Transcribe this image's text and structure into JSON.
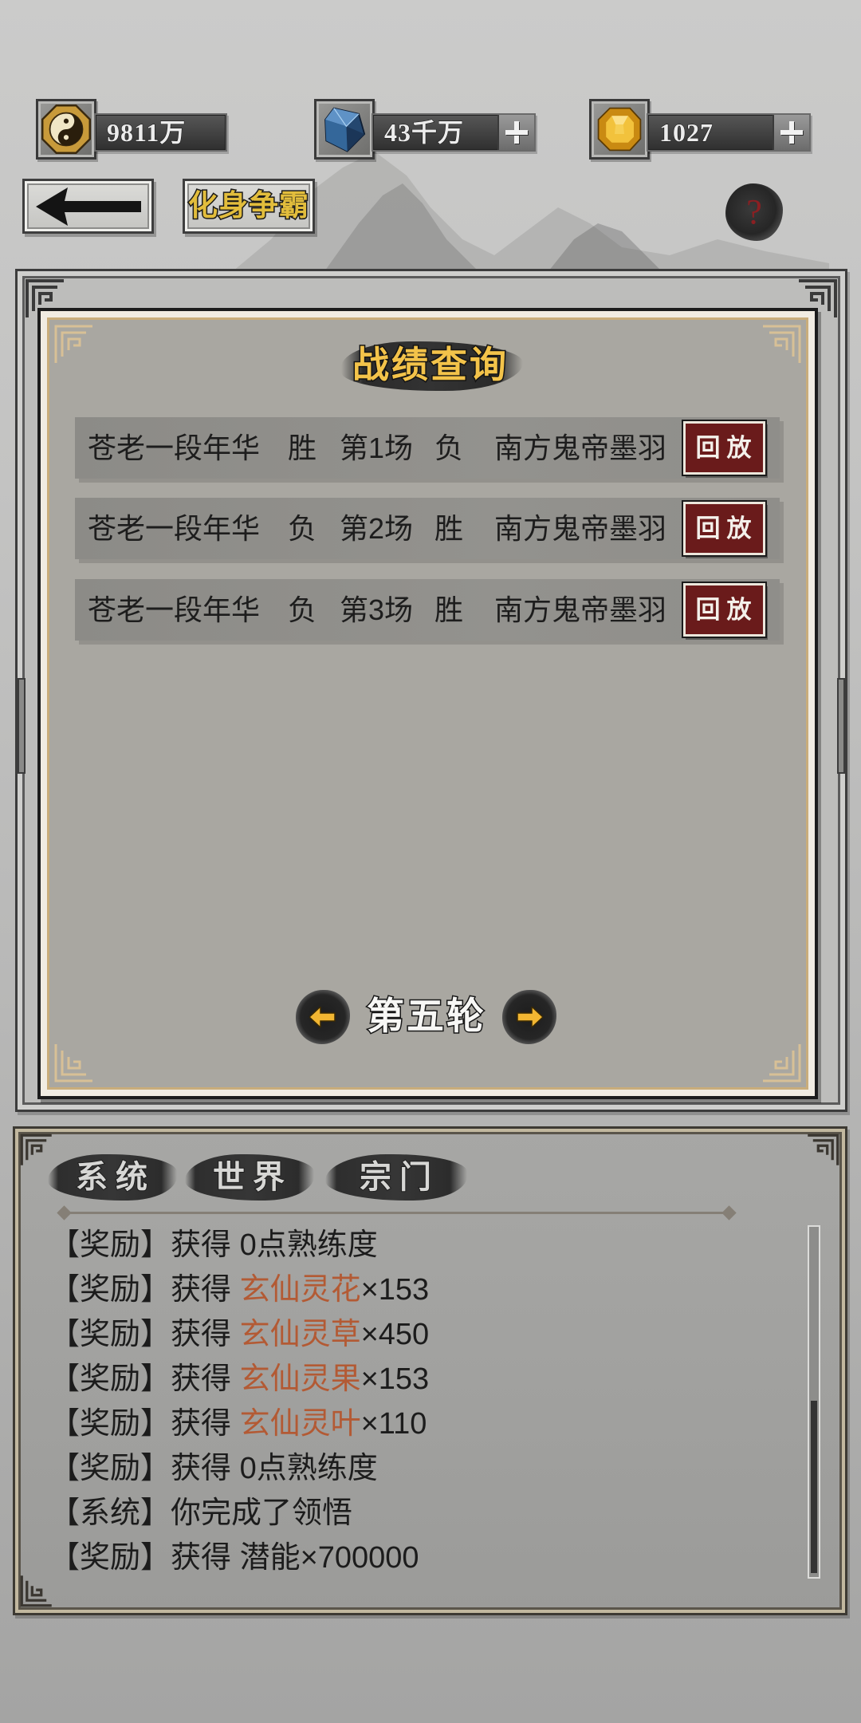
{
  "colors": {
    "highlight": "#b35a34",
    "title_gold": "#f3c34a",
    "replay_bg": "#6a1b1b",
    "help_red": "#8b1f22",
    "arrow_yellow": "#f2b632"
  },
  "resources": [
    {
      "icon": "yin-yang-icon",
      "value": "9811万"
    },
    {
      "icon": "crystal-icon",
      "value": "43千万"
    },
    {
      "icon": "gold-gem-icon",
      "value": "1027"
    }
  ],
  "header": {
    "back_icon": "arrow-left-icon",
    "mode_label": "化身争霸",
    "help_label": "?"
  },
  "panel": {
    "title": "战绩查询",
    "rows": [
      {
        "player_left": "苍老一段年华",
        "result_left": "胜",
        "round": "第1场",
        "result_right": "负",
        "player_right": "南方鬼帝墨羽",
        "action": "回放"
      },
      {
        "player_left": "苍老一段年华",
        "result_left": "负",
        "round": "第2场",
        "result_right": "胜",
        "player_right": "南方鬼帝墨羽",
        "action": "回放"
      },
      {
        "player_left": "苍老一段年华",
        "result_left": "负",
        "round": "第3场",
        "result_right": "胜",
        "player_right": "南方鬼帝墨羽",
        "action": "回放"
      }
    ],
    "round_label": "第五轮"
  },
  "chat": {
    "tabs": [
      "系统",
      "世界",
      "宗门"
    ],
    "lines": [
      {
        "tag": "【奖励】",
        "text": "获得 0点熟练度",
        "item": "",
        "suffix": ""
      },
      {
        "tag": "【奖励】",
        "text": "获得 ",
        "item": "玄仙灵花",
        "suffix": "×153"
      },
      {
        "tag": "【奖励】",
        "text": "获得 ",
        "item": "玄仙灵草",
        "suffix": "×450"
      },
      {
        "tag": "【奖励】",
        "text": "获得 ",
        "item": "玄仙灵果",
        "suffix": "×153"
      },
      {
        "tag": "【奖励】",
        "text": "获得 ",
        "item": "玄仙灵叶",
        "suffix": "×110"
      },
      {
        "tag": "【奖励】",
        "text": "获得 0点熟练度",
        "item": "",
        "suffix": ""
      },
      {
        "tag": "【系统】",
        "text": "你完成了领悟",
        "item": "",
        "suffix": ""
      },
      {
        "tag": "【奖励】",
        "text": "获得 潜能×700000",
        "item": "",
        "suffix": ""
      }
    ]
  }
}
